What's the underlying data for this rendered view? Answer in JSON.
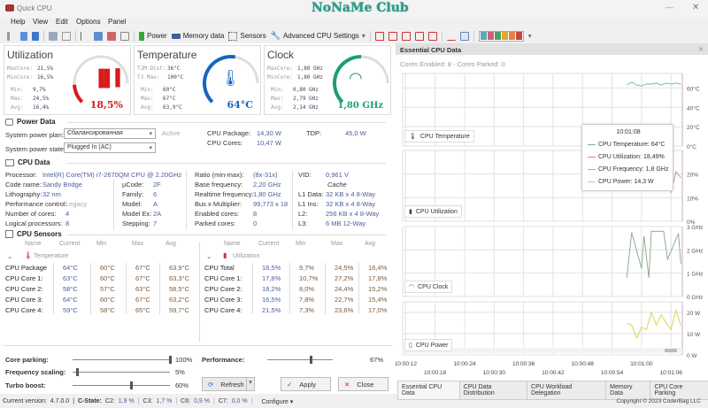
{
  "window": {
    "title": "Quick CPU",
    "watermark": "NoNaMe Club"
  },
  "menu": [
    "Help",
    "View",
    "Edit",
    "Options",
    "Panel"
  ],
  "toolbar": {
    "power": "Power",
    "memory": "Memory data",
    "sensors": "Sensors",
    "advanced": "Advanced CPU Settings",
    "palette": [
      "#5aa9b5",
      "#d35f7a",
      "#4f9e68",
      "#e0a92a",
      "#e0834a",
      "#c84545"
    ]
  },
  "gauges": {
    "utilization": {
      "title": "Utilization",
      "rows": [
        [
          "MaxCore:",
          "21,5%"
        ],
        [
          "MinCore:",
          "16,5%"
        ]
      ],
      "stats": [
        [
          "Min:",
          "9,7%"
        ],
        [
          "Max:",
          "24,5%"
        ],
        [
          "Avg:",
          "16,4%"
        ]
      ],
      "value": "18,5%",
      "fraction": 0.185,
      "color": "#d81b1b"
    },
    "temperature": {
      "title": "Temperature",
      "rows": [
        [
          "TJM Dist:",
          "36°C"
        ],
        [
          "TJ Max:",
          "100°C"
        ]
      ],
      "stats": [
        [
          "Min:",
          "60°C"
        ],
        [
          "Max:",
          "67°C"
        ],
        [
          "Avg:",
          "63,9°C"
        ]
      ],
      "value": "64°C",
      "fraction": 0.64,
      "color": "#1565c0"
    },
    "clock": {
      "title": "Clock",
      "rows": [
        [
          "MaxCore:",
          "1,80 GHz"
        ],
        [
          "MinCore:",
          "1,80 GHz"
        ]
      ],
      "stats": [
        [
          "Min:",
          "0,80 GHz"
        ],
        [
          "Max:",
          "2,79 GHz"
        ],
        [
          "Avg:",
          "2,14 GHz"
        ]
      ],
      "value": "1,80 GHz",
      "fraction": 0.6,
      "color": "#1e9e6e"
    }
  },
  "power": {
    "title": "Power Data",
    "plan_label": "System power plan:",
    "plan_value": "Сбалансированная",
    "active": "Active",
    "state_label": "System power state:",
    "state_value": "Plugged In (AC)",
    "pkg_label": "CPU Package:",
    "pkg_value": "14,30 W",
    "cores_label": "CPU Cores:",
    "cores_value": "10,47 W",
    "tdp_label": "TDP:",
    "tdp_value": "45,0 W"
  },
  "cpu": {
    "title": "CPU Data",
    "col1": [
      [
        "Processor:",
        "Intel(R) Core(TM) i7-2670QM CPU @ 2.20GHz"
      ],
      [
        "Code name:",
        "Sandy Bridge"
      ],
      [
        "Lithography:",
        "32 nm"
      ],
      [
        "Performance control:",
        "Legacy"
      ],
      [
        "Number of cores:",
        "4"
      ],
      [
        "Logical processors:",
        "8"
      ]
    ],
    "col2": [
      [
        "µCode:",
        "2F"
      ],
      [
        "Family:",
        "6"
      ],
      [
        "Model:",
        "A"
      ],
      [
        "Model Ex:",
        "2A"
      ],
      [
        "Stepping:",
        "7"
      ]
    ],
    "col3": [
      [
        "Ratio (min-max):",
        "(8x-31x)"
      ],
      [
        "Base frequency:",
        "2,20 GHz"
      ],
      [
        "Realtime frequency:",
        "1,80 GHz"
      ],
      [
        "Bus x Multiplier:",
        "99,773 x 18"
      ],
      [
        "Enabled cores:",
        "8"
      ],
      [
        "Parked cores:",
        "0"
      ]
    ],
    "vid_label": "VID:",
    "vid_value": "0,961 V",
    "cache_label": "Cache",
    "cache": [
      [
        "L1 Data:",
        "32 KB x 4  8-Way"
      ],
      [
        "L1 Ins:",
        "32 KB x 4  8-Way"
      ],
      [
        "L2:",
        "256 KB x 4  8-Way"
      ],
      [
        "L3:",
        "6 MB  12-Way"
      ]
    ]
  },
  "sensors": {
    "title": "CPU Sensors",
    "headers": [
      "Name",
      "Current",
      "Min",
      "Max",
      "Avg"
    ],
    "temp_group": "Temperature",
    "util_group": "Utilization",
    "temp_rows": [
      [
        "CPU Package",
        "64°C",
        "60°C",
        "67°C",
        "63,9°C"
      ],
      [
        "CPU Core 1:",
        "63°C",
        "60°C",
        "67°C",
        "63,3°C"
      ],
      [
        "CPU Core 2:",
        "58°C",
        "57°C",
        "63°C",
        "58,5°C"
      ],
      [
        "CPU Core 3:",
        "64°C",
        "60°C",
        "67°C",
        "63,2°C"
      ],
      [
        "CPU Core 4:",
        "59°C",
        "58°C",
        "65°C",
        "59,7°C"
      ]
    ],
    "util_rows": [
      [
        "CPU Total",
        "18,5%",
        "9,7%",
        "24,5%",
        "16,4%"
      ],
      [
        "CPU Core 1:",
        "17,8%",
        "10,7%",
        "27,2%",
        "17,8%"
      ],
      [
        "CPU Core 2:",
        "18,2%",
        "8,0%",
        "24,4%",
        "15,2%"
      ],
      [
        "CPU Core 3:",
        "16,5%",
        "7,8%",
        "22,7%",
        "15,4%"
      ],
      [
        "CPU Core 4:",
        "21,5%",
        "7,3%",
        "23,6%",
        "17,0%"
      ]
    ]
  },
  "controls": {
    "core_parking": {
      "label": "Core parking:",
      "value": "100%",
      "level": 1.0
    },
    "freq_scaling": {
      "label": "Frequency scaling:",
      "value": "5%",
      "level": 0.05
    },
    "turbo": {
      "label": "Turbo boost:",
      "value": "60%",
      "level": 0.6
    },
    "performance": {
      "label": "Performance:",
      "value": "67%",
      "level": 0.67
    },
    "refresh": "Refresh",
    "apply": "Apply",
    "close": "Close"
  },
  "status": {
    "version_label": "Current version:",
    "version": "4.7.0.0",
    "cstate": "C-State:",
    "c2": "C2:",
    "c2v": "1,9 %",
    "c3": "C3:",
    "c3v": "1,7 %",
    "c6": "C6:",
    "c6v": "0,9 %",
    "c7": "C7:",
    "c7v": "0,0 %",
    "configure": "Configure ▾"
  },
  "panel": {
    "title": "Essential CPU Data",
    "summary": "Cores Enabled: 8 - Cores Parked: 0",
    "tooltip": {
      "time": "10:01:08",
      "items": [
        "CPU Temperature:  64°C",
        "CPU Utilization:  18,49%",
        "CPU Frequency:  1,8 GHz",
        "CPU Power:  14,3 W"
      ]
    },
    "tabs": [
      "Essential CPU Data",
      "CPU Data Distribution",
      "CPU Workload Delegation",
      "Memory Data",
      "CPU Core Parking"
    ],
    "copyright": "Copyright © 2023 CoderBag LLC"
  },
  "chart_data": [
    {
      "type": "line",
      "label": "CPU Temperature",
      "color": "#6fb8a8",
      "ylim": [
        0,
        75
      ],
      "yticks": [
        "0°C",
        "20°C",
        "40°C",
        "60°C"
      ],
      "ytick_values": [
        0,
        20,
        40,
        60
      ],
      "x": [
        "10:00:57",
        "10:00:58",
        "10:00:59",
        "10:01:00",
        "10:01:01",
        "10:01:02",
        "10:01:03",
        "10:01:04",
        "10:01:05",
        "10:01:06",
        "10:01:07",
        "10:01:08"
      ],
      "values": [
        63,
        66,
        63,
        62,
        64,
        64,
        65,
        63,
        65,
        64,
        65,
        64
      ]
    },
    {
      "type": "line",
      "label": "CPU Utilization",
      "color": "#b58fb0",
      "ylim": [
        0,
        30
      ],
      "yticks": [
        "0%",
        "10%",
        "20%"
      ],
      "ytick_values": [
        0,
        10,
        20
      ],
      "x": [
        "10:01:06",
        "10:01:07",
        "10:01:08"
      ],
      "values": [
        12,
        21,
        18.49
      ]
    },
    {
      "type": "line",
      "label": "CPU Clock",
      "color": "#7fa88a",
      "ylim": [
        0,
        3
      ],
      "yticks": [
        "0 GHz",
        "1 GHz",
        "2 GHz",
        "3 GHz"
      ],
      "ytick_values": [
        0,
        1,
        2,
        3
      ],
      "x": [
        "10:00:57",
        "10:00:58",
        "10:01:00",
        "10:01:00.5",
        "10:01:01.5",
        "10:01:02",
        "10:01:04.5",
        "10:01:05.3",
        "10:01:07.5",
        "10:01:08"
      ],
      "values": [
        0.8,
        2.75,
        1.2,
        2.6,
        0.8,
        2.8,
        2.8,
        1.6,
        2.7,
        1.4
      ]
    },
    {
      "type": "line",
      "label": "CPU Power",
      "color": "#d8d040",
      "ylim": [
        0,
        25
      ],
      "yticks": [
        "0 W",
        "10 W",
        "20 W"
      ],
      "ytick_values": [
        0,
        10,
        20
      ],
      "x": [
        "10:00:57",
        "10:00:58",
        "10:00:59",
        "10:01:00",
        "10:01:01",
        "10:01:02",
        "10:01:03",
        "10:01:04",
        "10:01:05",
        "10:01:06",
        "10:01:07",
        "10:01:08"
      ],
      "values": [
        15,
        14,
        8,
        13,
        12,
        20,
        14,
        19,
        15,
        12,
        21,
        14
      ]
    }
  ],
  "time_axis": [
    "10:00:12",
    "10:00:18",
    "10:00:24",
    "10:00:30",
    "10:00:36",
    "10:00:42",
    "10:00:48",
    "10:00:54",
    "10:01:00",
    "10:01:06"
  ]
}
